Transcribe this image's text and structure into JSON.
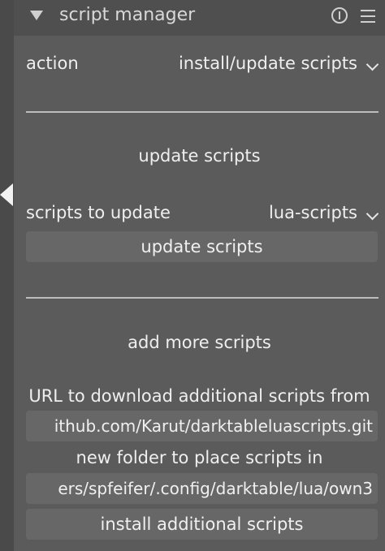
{
  "header": {
    "title": "script manager"
  },
  "action": {
    "label": "action",
    "value": "install/update scripts"
  },
  "update_section": {
    "title": "update scripts",
    "scripts_label": "scripts to update",
    "scripts_value": "lua-scripts",
    "button_label": "update scripts"
  },
  "add_section": {
    "title": "add more scripts",
    "url_label": "URL to download additional scripts from",
    "url_value": "ithub.com/Karut/darktableluascripts.git",
    "folder_label": "new folder to place scripts in",
    "folder_value": "ers/spfeifer/.config/darktable/lua/own3",
    "install_button_label": "install additional scripts"
  }
}
